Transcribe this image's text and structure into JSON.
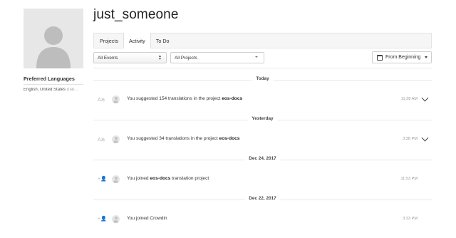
{
  "profile": {
    "username": "just_someone",
    "preferred_languages_title": "Preferred Languages",
    "language": "English, United States",
    "language_suffix": "(nat..."
  },
  "tabs": [
    {
      "label": "Projects",
      "active": false
    },
    {
      "label": "Activity",
      "active": true
    },
    {
      "label": "To Do",
      "active": false
    }
  ],
  "filters": {
    "events": "All Events",
    "projects": "All Projects",
    "date_range": "From Beginning"
  },
  "feed": [
    {
      "date": "Today",
      "entries": [
        {
          "icon": "suggest-translation-icon",
          "prefix": "You suggested 154 translations in the project ",
          "project": "eos-docs",
          "suffix": "",
          "time": "11:28 AM",
          "expandable": true
        }
      ]
    },
    {
      "date": "Yesterday",
      "entries": [
        {
          "icon": "suggest-translation-icon",
          "prefix": "You suggested 34 translations in the project ",
          "project": "eos-docs",
          "suffix": "",
          "time": "3:28 PM",
          "expandable": true
        }
      ]
    },
    {
      "date": "Dec 24, 2017",
      "entries": [
        {
          "icon": "join-project-icon",
          "prefix": "You joined ",
          "project": "eos-docs",
          "suffix": " translation project",
          "time": "11:53 PM",
          "expandable": false
        }
      ]
    },
    {
      "date": "Dec 22, 2017",
      "entries": [
        {
          "icon": "join-project-icon",
          "prefix": "You joined Crowdin",
          "project": "",
          "suffix": "",
          "time": "3:33 PM",
          "expandable": false
        }
      ]
    }
  ]
}
